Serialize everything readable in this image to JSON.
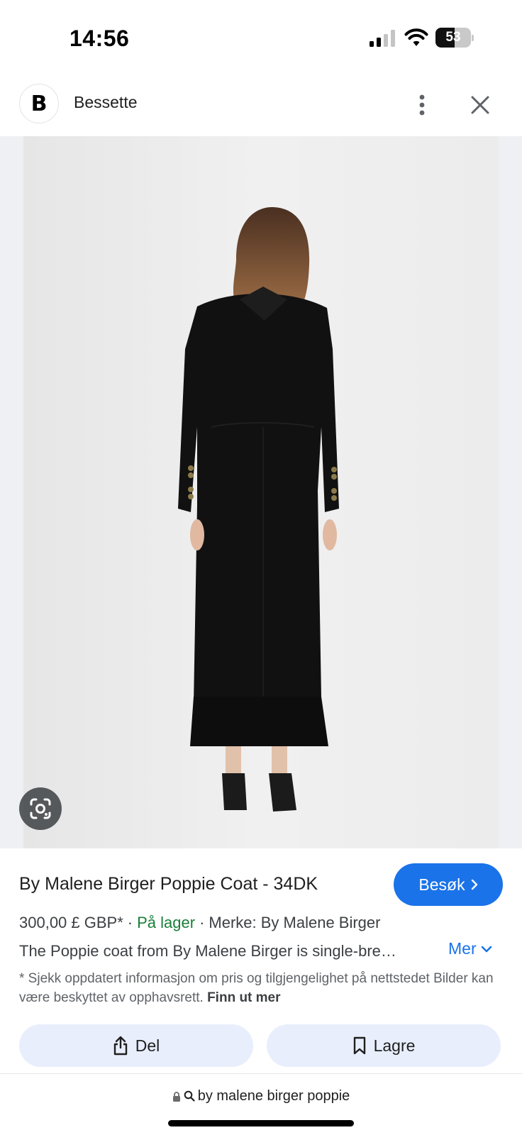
{
  "status_bar": {
    "time": "14:56",
    "battery_level": "53",
    "battery_fraction": 0.53,
    "signal_icon": "cellular-signal-icon",
    "wifi_icon": "wifi-icon"
  },
  "header": {
    "logo_letter": "B",
    "site_name": "Bessette",
    "more_icon": "more-vert-icon",
    "close_icon": "close-icon"
  },
  "image": {
    "lens_icon": "google-lens-icon"
  },
  "product": {
    "title": "By Malene Birger Poppie Coat - 34DK",
    "visit_label": "Besøk",
    "price": "300,00 £ GBP*",
    "separator": "·",
    "stock": "På lager",
    "brand": "Merke: By Malene Birger",
    "description": "The Poppie coat from By Malene Birger is single-breasted and tailored",
    "more_label": "Mer",
    "disclaimer_text": "* Sjekk oppdatert informasjon om pris og tilgjengelighet på nettstedet Bilder kan være beskyttet av opphavsrett.",
    "disclaimer_link": "Finn ut mer"
  },
  "actions": {
    "share_label": "Del",
    "save_label": "Lagre"
  },
  "url_bar": {
    "query": "by malene birger poppie"
  },
  "colors": {
    "accent": "#1a73e8",
    "stock_green": "#188038",
    "button_bg": "#e8eefc"
  }
}
